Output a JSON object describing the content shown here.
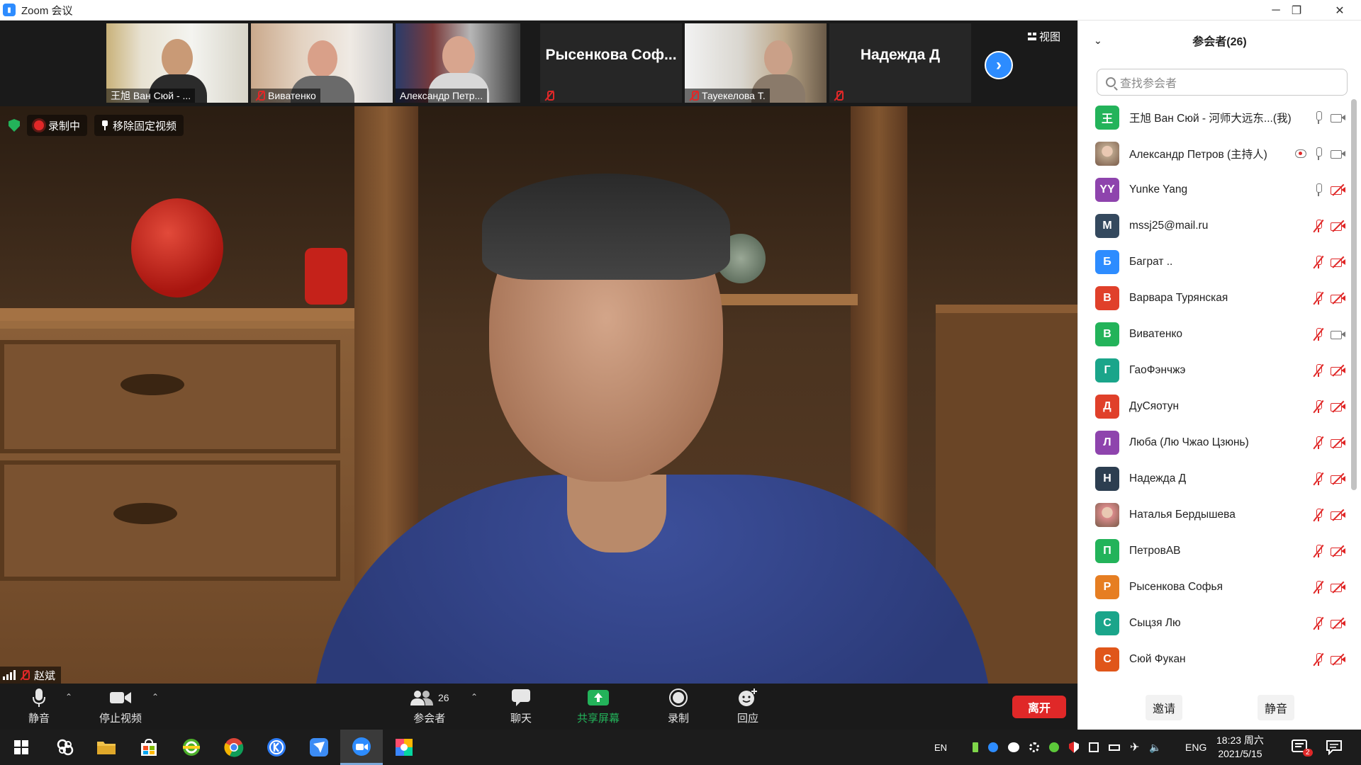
{
  "window": {
    "title": "Zoom 会议",
    "controls": {
      "minimize": "─",
      "restore": "❐",
      "close": "✕"
    }
  },
  "strip": {
    "view_label": "视图",
    "thumbnails": [
      {
        "name": "王旭 Ван Сюй - ...",
        "muted": false,
        "type": "video"
      },
      {
        "name": "Виватенко",
        "muted": true,
        "type": "video"
      },
      {
        "name": "Александр Петр...",
        "muted": false,
        "type": "video"
      },
      {
        "name": "Рысенкова Соф...",
        "muted": true,
        "type": "name"
      },
      {
        "name": "Тауекелова Т.",
        "muted": true,
        "type": "video"
      },
      {
        "name": "Надежда Д",
        "muted": true,
        "type": "name"
      }
    ]
  },
  "main_video": {
    "recording_label": "录制中",
    "unpin_label": "移除固定视频",
    "speaker_name": "赵斌"
  },
  "toolbar": {
    "mute": "静音",
    "stop_video": "停止视频",
    "participants": "参会者",
    "participant_count": "26",
    "chat": "聊天",
    "share_screen": "共享屏幕",
    "record": "录制",
    "reactions": "回应",
    "leave": "离开",
    "share_color": "#23b35a",
    "leave_color": "#e02828"
  },
  "panel": {
    "title": "参会者(26)",
    "search_placeholder": "查找参会者",
    "invite": "邀请",
    "mute_all": "静音",
    "participants": [
      {
        "initial": "王",
        "color": "#23b35a",
        "name": "王旭 Ван Сюй - 河师大远东...",
        "tag": "(我)",
        "mic": "on",
        "cam": "on",
        "photo": false
      },
      {
        "initial": "",
        "color": "#b9a38a",
        "name": "Александр Петров (主持人)",
        "tag": "",
        "mic": "on",
        "cam": "on",
        "photo": true,
        "cloud": true
      },
      {
        "initial": "YY",
        "color": "#8e44ad",
        "name": "Yunke Yang",
        "tag": "",
        "mic": "on",
        "cam": "off",
        "photo": false
      },
      {
        "initial": "M",
        "color": "#34495e",
        "name": "mssj25@mail.ru",
        "tag": "",
        "mic": "off",
        "cam": "off",
        "photo": false
      },
      {
        "initial": "Б",
        "color": "#2d8cff",
        "name": "Баграт ..",
        "tag": "",
        "mic": "off",
        "cam": "off",
        "photo": false
      },
      {
        "initial": "В",
        "color": "#e0402a",
        "name": "Варвара Турянская",
        "tag": "",
        "mic": "off",
        "cam": "off",
        "photo": false
      },
      {
        "initial": "В",
        "color": "#23b35a",
        "name": "Виватенко",
        "tag": "",
        "mic": "off",
        "cam": "on",
        "photo": false
      },
      {
        "initial": "Г",
        "color": "#1aa58a",
        "name": "ГаоФэнчжэ",
        "tag": "",
        "mic": "off",
        "cam": "off",
        "photo": false
      },
      {
        "initial": "Д",
        "color": "#e0402a",
        "name": "ДуСяотун",
        "tag": "",
        "mic": "off",
        "cam": "off",
        "photo": false
      },
      {
        "initial": "Л",
        "color": "#8e44ad",
        "name": "Люба (Лю Чжао Цзюнь)",
        "tag": "",
        "mic": "off",
        "cam": "off",
        "photo": false
      },
      {
        "initial": "Н",
        "color": "#2c3e50",
        "name": "Надежда Д",
        "tag": "",
        "mic": "off",
        "cam": "off",
        "photo": false
      },
      {
        "initial": "",
        "color": "#d98a8a",
        "name": "Наталья Бердышева",
        "tag": "",
        "mic": "off",
        "cam": "off",
        "photo": true
      },
      {
        "initial": "П",
        "color": "#23b35a",
        "name": "ПетровАВ",
        "tag": "",
        "mic": "off",
        "cam": "off",
        "photo": false
      },
      {
        "initial": "Р",
        "color": "#e67e22",
        "name": "Рысенкова Софья",
        "tag": "",
        "mic": "off",
        "cam": "off",
        "photo": false
      },
      {
        "initial": "С",
        "color": "#1aa58a",
        "name": "Сыцзя Лю",
        "tag": "",
        "mic": "off",
        "cam": "off",
        "photo": false
      },
      {
        "initial": "С",
        "color": "#e0561a",
        "name": "Сюй Фукан",
        "tag": "",
        "mic": "off",
        "cam": "off",
        "photo": false
      }
    ]
  },
  "taskbar": {
    "lang_short": "EN",
    "lang": "ENG",
    "time": "18:23 周六",
    "date": "2021/5/15",
    "notification_count": "2",
    "icons": [
      "windows-start-icon",
      "baidu-icon",
      "file-explorer-icon",
      "store-icon",
      "browser-360-icon",
      "chrome-icon",
      "kingsoft-icon",
      "feishu-icon",
      "zoom-icon",
      "colorful-app-icon"
    ]
  }
}
